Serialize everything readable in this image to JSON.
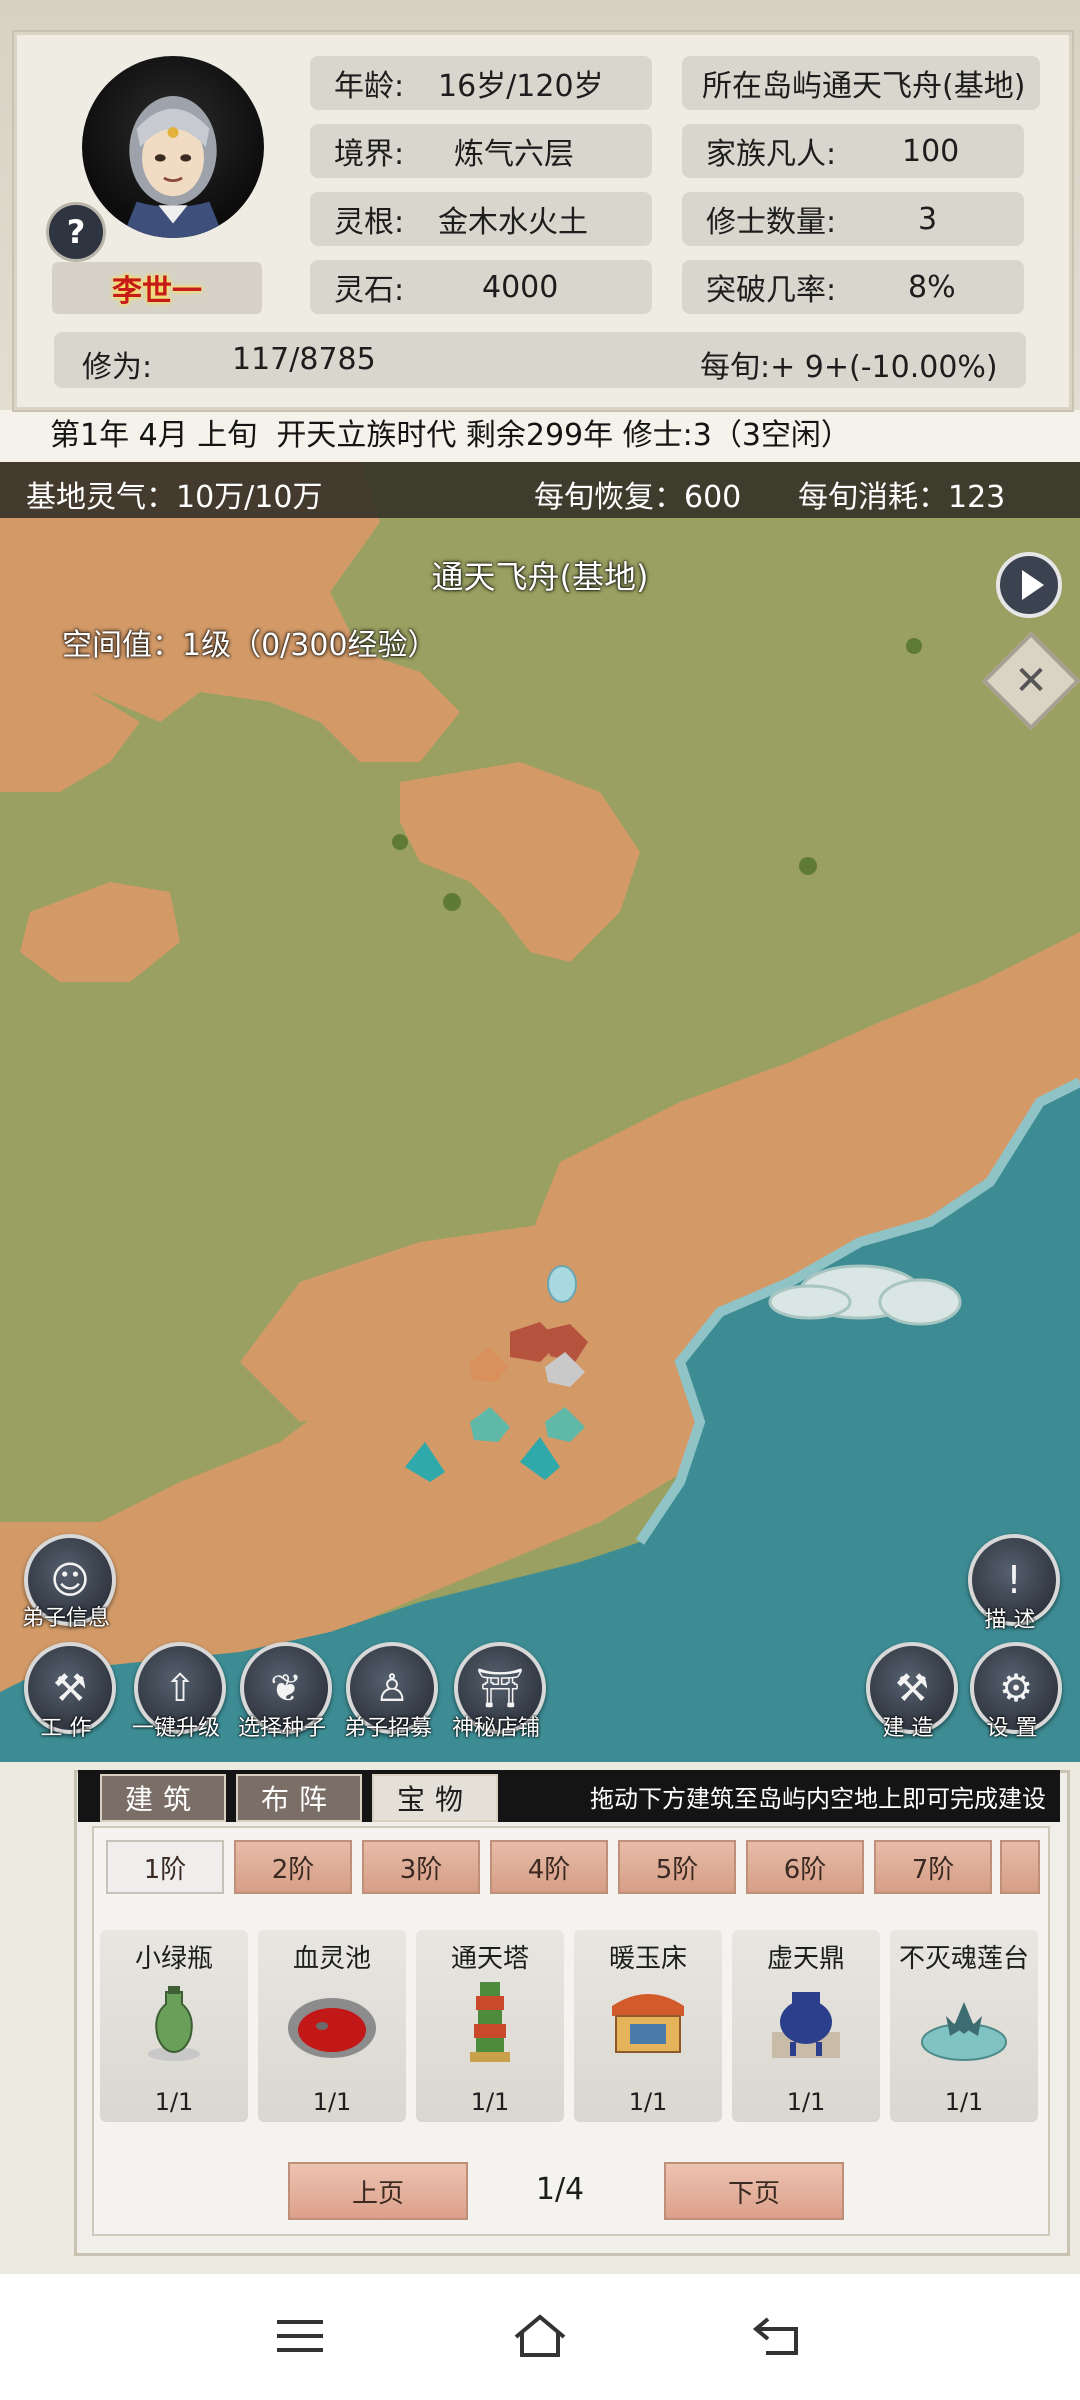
{
  "character": {
    "name": "李世一",
    "age_label": "年龄:",
    "age_value": "16岁/120岁",
    "realm_label": "境界:",
    "realm_value": "炼气六层",
    "root_label": "灵根:",
    "root_value": "金木水火土",
    "stones_label": "灵石:",
    "stones_value": "4000",
    "island_text": "所在岛屿通天飞舟(基地)",
    "mortals_label": "家族凡人:",
    "mortals_value": "100",
    "cultivators_label": "修士数量:",
    "cultivators_value": "3",
    "breakthrough_label": "突破几率:",
    "breakthrough_value": "8%",
    "cultivation_label": "修为:",
    "cultivation_value": "117/8785",
    "per_period": "每旬:+ 9+(-10.00%)",
    "help_symbol": "?"
  },
  "status_line": "第1年 4月 上旬  开天立族时代 剩余299年 修士:3（3空闲）",
  "aura_bar": {
    "base_aura": "基地灵气：10万/10万",
    "recovery": "每旬恢复：600",
    "consumption": "每旬消耗：123"
  },
  "map": {
    "title": "通天飞舟(基地)",
    "space_value": "空间值：1级（0/300经验）"
  },
  "map_buttons": {
    "disciple_info": "弟子信息",
    "describe": "描 述",
    "work": "工 作",
    "upgrade_all": "一键升级",
    "select_seeds": "选择种子",
    "recruit": "弟子招募",
    "shop": "神秘店铺",
    "build": "建 造",
    "settings": "设 置"
  },
  "icons": {
    "play": "play-icon",
    "close": "close-icon",
    "help": "help-icon",
    "menu": "menu-icon",
    "home": "home-icon",
    "back": "back-icon"
  },
  "build_panel": {
    "tabs": [
      "建筑",
      "布阵",
      "宝物"
    ],
    "active_tab": 2,
    "hint": "拖动下方建筑至岛屿内空地上即可完成建设",
    "tiers": [
      "1阶",
      "2阶",
      "3阶",
      "4阶",
      "5阶",
      "6阶",
      "7阶"
    ],
    "active_tier": 0,
    "items": [
      {
        "name": "小绿瓶",
        "count": "1/1"
      },
      {
        "name": "血灵池",
        "count": "1/1"
      },
      {
        "name": "通天塔",
        "count": "1/1"
      },
      {
        "name": "暖玉床",
        "count": "1/1"
      },
      {
        "name": "虚天鼎",
        "count": "1/1"
      },
      {
        "name": "不灭魂莲台",
        "count": "1/1"
      }
    ],
    "prev_page": "上页",
    "next_page": "下页",
    "page_indicator": "1/4"
  },
  "colors": {
    "land": "#9aa061",
    "sand": "#d39a68",
    "sea": "#3d8c94",
    "name_red": "#c51b1b",
    "tier_button": "#d79e86"
  }
}
